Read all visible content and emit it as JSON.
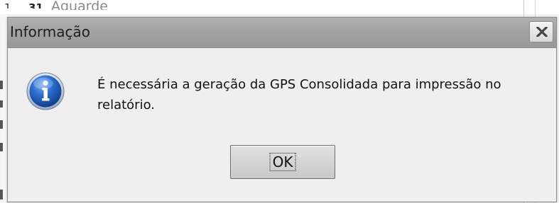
{
  "background": {
    "row_index": "1",
    "row_column": "31",
    "row_status": "Aguarde"
  },
  "dialog": {
    "title": "Informação",
    "message": "É necessária a geração da GPS Consolidada para impressão no relatório.",
    "ok_label": "OK",
    "icon": "info-icon",
    "close_icon": "close-icon"
  },
  "colors": {
    "titlebar": "#a3a3a3",
    "dialog_bg": "#efefef",
    "info_icon_blue": "#1f5fbf"
  }
}
